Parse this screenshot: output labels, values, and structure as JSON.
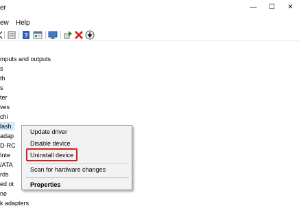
{
  "window": {
    "title_fragment": "er",
    "controls": {
      "minimize": "—",
      "maximize": "☐",
      "close": "✕"
    }
  },
  "menubar": {
    "items": [
      "ew",
      "Help"
    ]
  },
  "toolbar": {
    "icons": [
      "back-icon",
      "forward-icon",
      "device-manager-icon",
      "help-icon",
      "properties-view-icon",
      "monitor-icon",
      "update-driver-icon",
      "uninstall-icon",
      "download-icon"
    ]
  },
  "tree": {
    "items": [
      "mputs and outputs",
      "s",
      "th",
      "s",
      "ter",
      "ves",
      "chi",
      "lash",
      "adap",
      "D-RC",
      "Inte",
      "/ATA",
      "rds",
      "ed ot",
      "ne",
      "k adapters"
    ],
    "selected_index": 7
  },
  "context_menu": {
    "items": [
      {
        "label": "Update driver",
        "bold": false
      },
      {
        "label": "Disable device",
        "bold": false
      },
      {
        "label": "Uninstall device",
        "bold": false,
        "highlighted": true
      },
      {
        "label": "Scan for hardware changes",
        "bold": false
      },
      {
        "label": "Properties",
        "bold": true
      }
    ],
    "highlight_color": "#d21f1f"
  },
  "colors": {
    "selection": "#cde8ff",
    "menu_bg": "#f2f2f2",
    "uninstall_red": "#d21f1f",
    "update_green": "#1a8a2a"
  }
}
